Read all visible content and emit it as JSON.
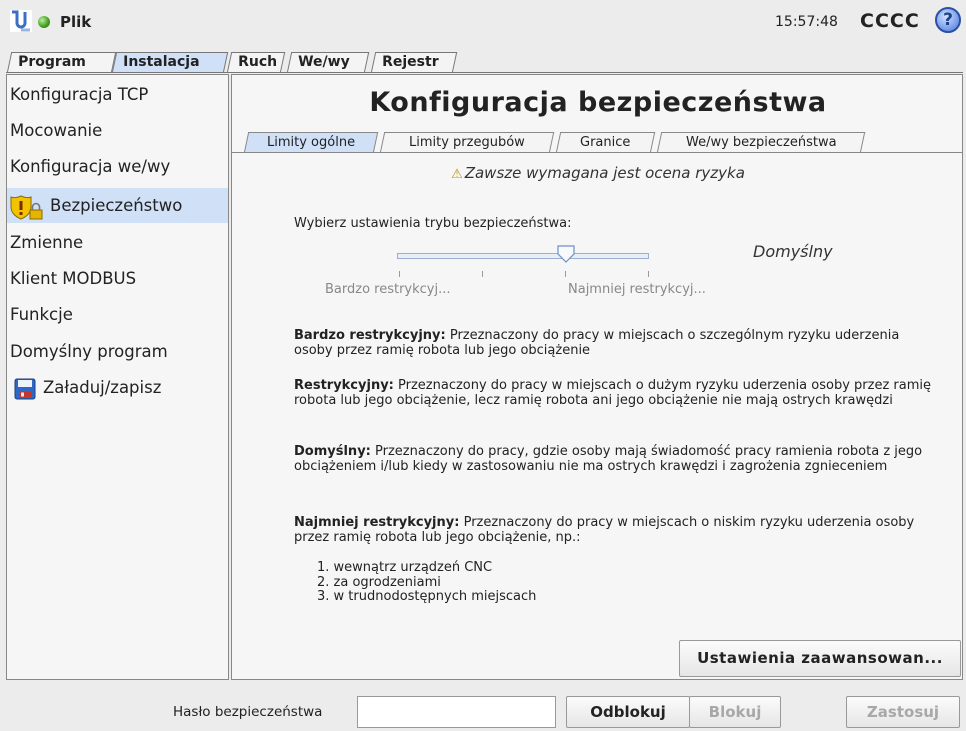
{
  "header": {
    "file_menu_label": "Plik",
    "clock": "15:57:48",
    "robot_name": "CCCC",
    "help_label": "?"
  },
  "main_tabs": [
    {
      "label": "Program",
      "active": false
    },
    {
      "label": "Instalacja",
      "active": true
    },
    {
      "label": "Ruch",
      "active": false
    },
    {
      "label": "We/wy",
      "active": false
    },
    {
      "label": "Rejestr",
      "active": false
    }
  ],
  "sidebar": {
    "items": [
      {
        "label": "Konfiguracja TCP",
        "active": false
      },
      {
        "label": "Mocowanie",
        "active": false
      },
      {
        "label": "Konfiguracja we/wy",
        "active": false
      },
      {
        "label": "Bezpieczeństwo",
        "active": true,
        "icon": "shield-lock-icon"
      },
      {
        "label": "Zmienne",
        "active": false
      },
      {
        "label": "Klient MODBUS",
        "active": false
      },
      {
        "label": "Funkcje",
        "active": false
      },
      {
        "label": "Domyślny program",
        "active": false
      },
      {
        "label": "Załaduj/zapisz",
        "active": false,
        "icon": "floppy-disk-icon"
      }
    ]
  },
  "main": {
    "title": "Konfiguracja bezpieczeństwa",
    "tabs": [
      {
        "label": "Limity ogólne",
        "active": true
      },
      {
        "label": "Limity przegubów",
        "active": false
      },
      {
        "label": "Granice",
        "active": false
      },
      {
        "label": "We/wy bezpieczeństwa",
        "active": false
      }
    ],
    "warning": "Zawsze wymagana jest ocena ryzyka",
    "mode_prompt": "Wybierz ustawienia trybu bezpieczeństwa:",
    "mode_value": "Domyślny",
    "slider": {
      "min_label": "Bardzo restrykcyj...",
      "max_label": "Najmniej restrykcyj...",
      "positions": 4,
      "selected_index": 2
    },
    "descriptions": [
      {
        "term": "Bardzo restrykcyjny:",
        "text": " Przeznaczony do pracy w miejscach o szczególnym ryzyku uderzenia osoby przez ramię robota lub jego obciążenie"
      },
      {
        "term": "Restrykcyjny:",
        "text": " Przeznaczony do pracy w miejscach o dużym ryzyku uderzenia osoby przez ramię robota lub jego obciążenie, lecz ramię robota ani jego obciążenie nie mają ostrych krawędzi"
      },
      {
        "term": "Domyślny:",
        "text": " Przeznaczony do pracy, gdzie osoby mają świadomość pracy ramienia robota z jego obciążeniem i/lub kiedy w zastosowaniu nie ma ostrych krawędzi i zagrożenia zgnieceniem"
      },
      {
        "term": "Najmniej restrykcyjny:",
        "text": " Przeznaczony do pracy w miejscach o niskim ryzyku uderzenia osoby przez ramię robota lub jego obciążenie, np.:"
      }
    ],
    "examples": [
      "wewnątrz urządzeń CNC",
      "za ogrodzeniami",
      "w trudnodostępnych miejscach"
    ],
    "advanced_button": "Ustawienia zaawansowan..."
  },
  "footer": {
    "password_label": "Hasło bezpieczeństwa",
    "password_value": "",
    "unlock_button": "Odblokuj",
    "lock_button": "Blokuj",
    "apply_button": "Zastosuj"
  },
  "colors": {
    "active_tab": "#cfe0f7",
    "status_ok": "#3f9a1c",
    "help_blue": "#2a4fa3",
    "warning_yellow": "#f2c400"
  }
}
